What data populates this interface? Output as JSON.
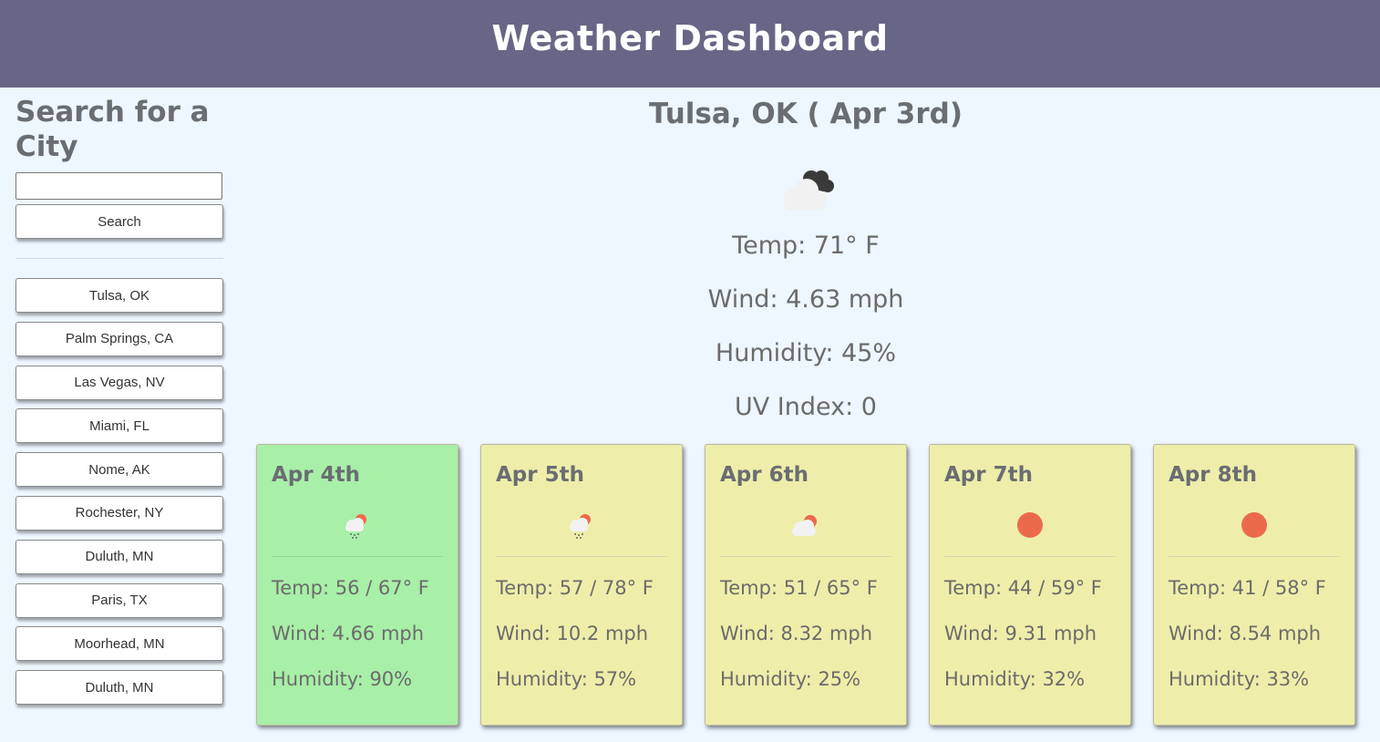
{
  "header": {
    "title": "Weather Dashboard"
  },
  "sidebar": {
    "heading": "Search for a City",
    "search_value": "",
    "search_label": "Search",
    "history": [
      "Tulsa, OK",
      "Palm Springs, CA",
      "Las Vegas, NV",
      "Miami, FL",
      "Nome, AK",
      "Rochester, NY",
      "Duluth, MN",
      "Paris, TX",
      "Moorhead, MN",
      "Duluth, MN"
    ]
  },
  "current": {
    "title": "Tulsa, OK ( Apr 3rd)",
    "icon": "cloudy-night-icon",
    "temp": "Temp: 71° F",
    "wind": "Wind: 4.63 mph",
    "humidity": "Humidity: 45%",
    "uv": "UV Index: 0"
  },
  "forecast": [
    {
      "date": "Apr 4th",
      "icon": "rain-sun-icon",
      "temp": "Temp: 56 / 67° F",
      "wind": "Wind: 4.66 mph",
      "humidity": "Humidity: 90%",
      "color": "#a8efa8"
    },
    {
      "date": "Apr 5th",
      "icon": "rain-sun-icon",
      "temp": "Temp: 57 / 78° F",
      "wind": "Wind: 10.2 mph",
      "humidity": "Humidity: 57%",
      "color": "#eeeeaa"
    },
    {
      "date": "Apr 6th",
      "icon": "partly-cloudy-icon",
      "temp": "Temp: 51 / 65° F",
      "wind": "Wind: 8.32 mph",
      "humidity": "Humidity: 25%",
      "color": "#eeeeaa"
    },
    {
      "date": "Apr 7th",
      "icon": "sun-icon",
      "temp": "Temp: 44 / 59° F",
      "wind": "Wind: 9.31 mph",
      "humidity": "Humidity: 32%",
      "color": "#eeeeaa"
    },
    {
      "date": "Apr 8th",
      "icon": "sun-icon",
      "temp": "Temp: 41 / 58° F",
      "wind": "Wind: 8.54 mph",
      "humidity": "Humidity: 33%",
      "color": "#eeeeaa"
    }
  ],
  "colors": {
    "header": "#676686",
    "background": "#eef6ff",
    "sun": "#ec6a4c"
  }
}
